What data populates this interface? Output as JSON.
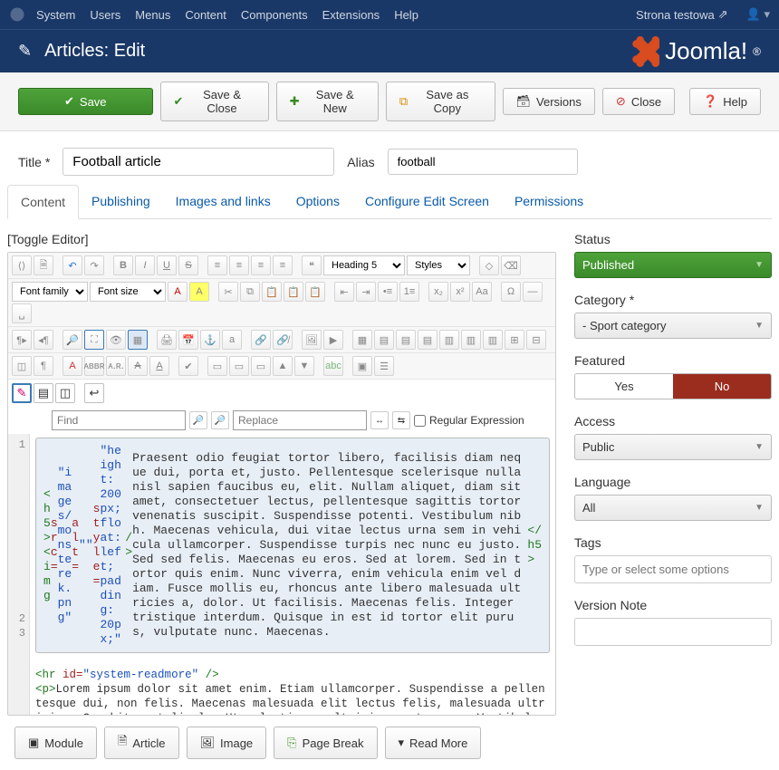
{
  "topnav": {
    "items": [
      "System",
      "Users",
      "Menus",
      "Content",
      "Components",
      "Extensions",
      "Help"
    ],
    "site": "Strona testowa"
  },
  "header": {
    "title": "Articles: Edit",
    "logo": "Joomla!"
  },
  "toolbar": {
    "save": "Save",
    "saveClose": "Save & Close",
    "saveNew": "Save & New",
    "saveCopy": "Save as Copy",
    "versions": "Versions",
    "close": "Close",
    "help": "Help"
  },
  "form": {
    "titleLabel": "Title *",
    "titleValue": "Football article",
    "aliasLabel": "Alias",
    "aliasValue": "football"
  },
  "tabs": [
    "Content",
    "Publishing",
    "Images and links",
    "Options",
    "Configure Edit Screen",
    "Permissions"
  ],
  "toggleEditor": "[Toggle Editor]",
  "editor": {
    "formatSel": "Heading 5",
    "stylesSel": "Styles",
    "fontFamily": "Font family",
    "fontSize": "Font size",
    "findPlaceholder": "Find",
    "replacePlaceholder": "Replace",
    "regexLabel": "Regular Expression",
    "gutter": [
      "1",
      "2",
      "3"
    ]
  },
  "codeHtml": "<span class='sel'><span style='color:#207a20'>&lt;h5&gt;&lt;img</span> <span style='color:#a02020'>src=</span><span style='color:#1a50b8'>\"images/monsterek.png\"</span> <span style='color:#a02020'>alt=</span><span style='color:#1a50b8'>\"\"</span> <span style='color:#a02020'>style=</span><span style='color:#1a50b8'>\"height: 200px; float: left; padding: 20px;\"</span> <span style='color:#207a20'>/&gt;</span>Praesent odio feugiat tortor libero, facilisis diam neque dui, porta et, justo. Pellentesque scelerisque nulla nisl sapien faucibus eu, elit. Nullam aliquet, diam sit amet, consectetuer lectus, pellentesque sagittis tortor venenatis suscipit. Suspendisse potenti. Vestibulum nibh. Maecenas vehicula, dui vitae lectus urna sem in vehicula ullamcorper. Suspendisse turpis nec nunc eu justo. Sed sed felis. Maecenas eu eros. Sed at lorem. Sed in tortor quis enim. Nunc viverra, enim vehicula enim vel diam. Fusce mollis eu, rhoncus ante libero malesuada ultricies a, dolor. Ut facilisis. Maecenas felis. Integer tristique interdum. Quisque in est id tortor elit purus, vulputate nunc. Maecenas.<span style='color:#207a20'>&lt;/h5&gt;</span></span>\n<span style='color:#207a20'>&lt;hr</span> <span style='color:#a02020'>id=</span><span style='color:#1a50b8'>\"system-readmore\"</span> <span style='color:#207a20'>/&gt;</span>\n<span style='color:#207a20'>&lt;p&gt;</span>Lorem ipsum dolor sit amet enim. Etiam ullamcorper. Suspendisse a pellentesque dui, non felis. Maecenas malesuada elit lectus felis, malesuada ultricies. Curabitur et ligula. Ut molestie a, ultricies porta urna. Vestibulum commodo volutpat a, convallis ac, laoreet enim. Phasellus fermentum in, dolor. Pellentesque facilisis. Nulla imperdiet sit amet magna. Vestibulum dapibus, mauris nec malesuada fames ac turpis velit, rhoncus eu, luctus et interdum adipiscing wisi. Aliquam erat ac",
  "bottomBtns": {
    "module": "Module",
    "article": "Article",
    "image": "Image",
    "pageBreak": "Page Break",
    "readMore": "Read More"
  },
  "side": {
    "statusLabel": "Status",
    "statusValue": "Published",
    "categoryLabel": "Category *",
    "categoryValue": "- Sport category",
    "featuredLabel": "Featured",
    "featuredYes": "Yes",
    "featuredNo": "No",
    "accessLabel": "Access",
    "accessValue": "Public",
    "languageLabel": "Language",
    "languageValue": "All",
    "tagsLabel": "Tags",
    "tagsPlaceholder": "Type or select some options",
    "versionNoteLabel": "Version Note"
  }
}
